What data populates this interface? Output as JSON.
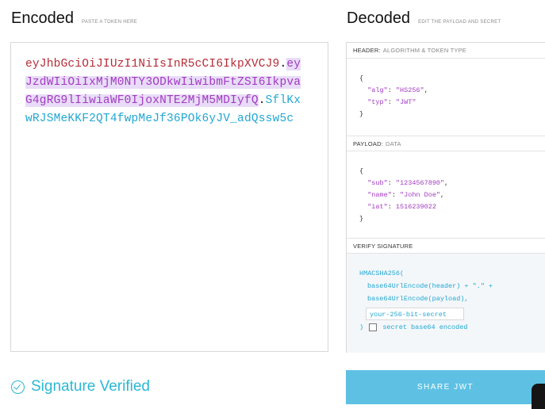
{
  "encoded": {
    "title": "Encoded",
    "hint": "PASTE A TOKEN HERE",
    "token": {
      "header": "eyJhbGciOiJIUzI1NiIsInR5cCI6IkpXVCJ9",
      "dot1": ".",
      "payload": "eyJzdWIiOiIxMjM0NTY3ODkwIiwibmFtZSI6IkpvaG4gRG9lIiwiaWF0IjoxNTE2MjM5MDIyfQ",
      "dot2": ".",
      "signature": "SflKxwRJSMeKKF2QT4fwpMeJf36POk6yJV_adQssw5c"
    }
  },
  "decoded": {
    "title": "Decoded",
    "hint": "EDIT THE PAYLOAD AND SECRET",
    "header": {
      "label": "HEADER:",
      "sublabel": "ALGORITHM & TOKEN TYPE",
      "alg_key": "\"alg\"",
      "alg_value": "\"HS256\"",
      "typ_key": "\"typ\"",
      "typ_value": "\"JWT\""
    },
    "payload": {
      "label": "PAYLOAD:",
      "sublabel": "DATA",
      "sub_key": "\"sub\"",
      "sub_value": "\"1234567890\"",
      "name_key": "\"name\"",
      "name_value": "\"John Doe\"",
      "iat_key": "\"iat\"",
      "iat_value": "1516239022"
    },
    "verify": {
      "label": "VERIFY SIGNATURE",
      "fn": "HMACSHA256(",
      "line1": "base64UrlEncode(header) + \".\" +",
      "line2": "base64UrlEncode(payload),",
      "secret_placeholder": "your-256-bit-secret",
      "close": ")",
      "checkbox_label": "secret base64 encoded"
    }
  },
  "status": {
    "verified_label": "Signature Verified",
    "color": "#2bb8d3"
  },
  "actions": {
    "share_label": "SHARE JWT"
  }
}
